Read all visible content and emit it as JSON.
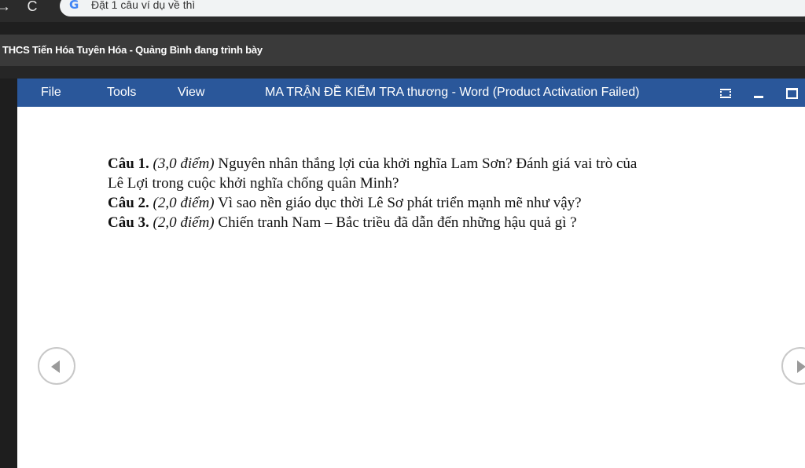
{
  "browser": {
    "back_glyph": "→",
    "reload_glyph": "C",
    "search_engine_icon": "google-g-icon",
    "search_engine_glyph": "G",
    "omnibox_text": "Đặt 1 câu ví dụ về thì"
  },
  "presenter": {
    "text": "THCS Tiến Hóa Tuyên Hóa - Quảng Bình đang trình bày"
  },
  "word": {
    "menu": [
      "File",
      "Tools",
      "View"
    ],
    "title": "MA TRẬN ĐỀ KIỂM TRA thương - Word (Product Activation Failed)",
    "accent_color": "#2a579a"
  },
  "document": {
    "questions": [
      {
        "num": "Câu 1.",
        "points": "(3,0 điểm)",
        "lines": [
          "Nguyên nhân thắng lợi của khởi nghĩa Lam Sơn? Đánh giá vai trò của",
          "Lê Lợi trong cuộc khởi nghĩa chống quân Minh?"
        ]
      },
      {
        "num": "Câu 2.",
        "points": "(2,0 điểm)",
        "lines": [
          "Vì sao nền giáo dục thời Lê Sơ phát triển mạnh mẽ như vậy?"
        ]
      },
      {
        "num": "Câu 3.",
        "points": "(2,0 điểm)",
        "lines": [
          "Chiến tranh Nam – Bắc triều  đã dẫn đến những hậu quả gì ?"
        ]
      }
    ]
  },
  "navigation": {
    "prev_icon": "chevron-left-icon",
    "next_icon": "chevron-right-icon"
  }
}
